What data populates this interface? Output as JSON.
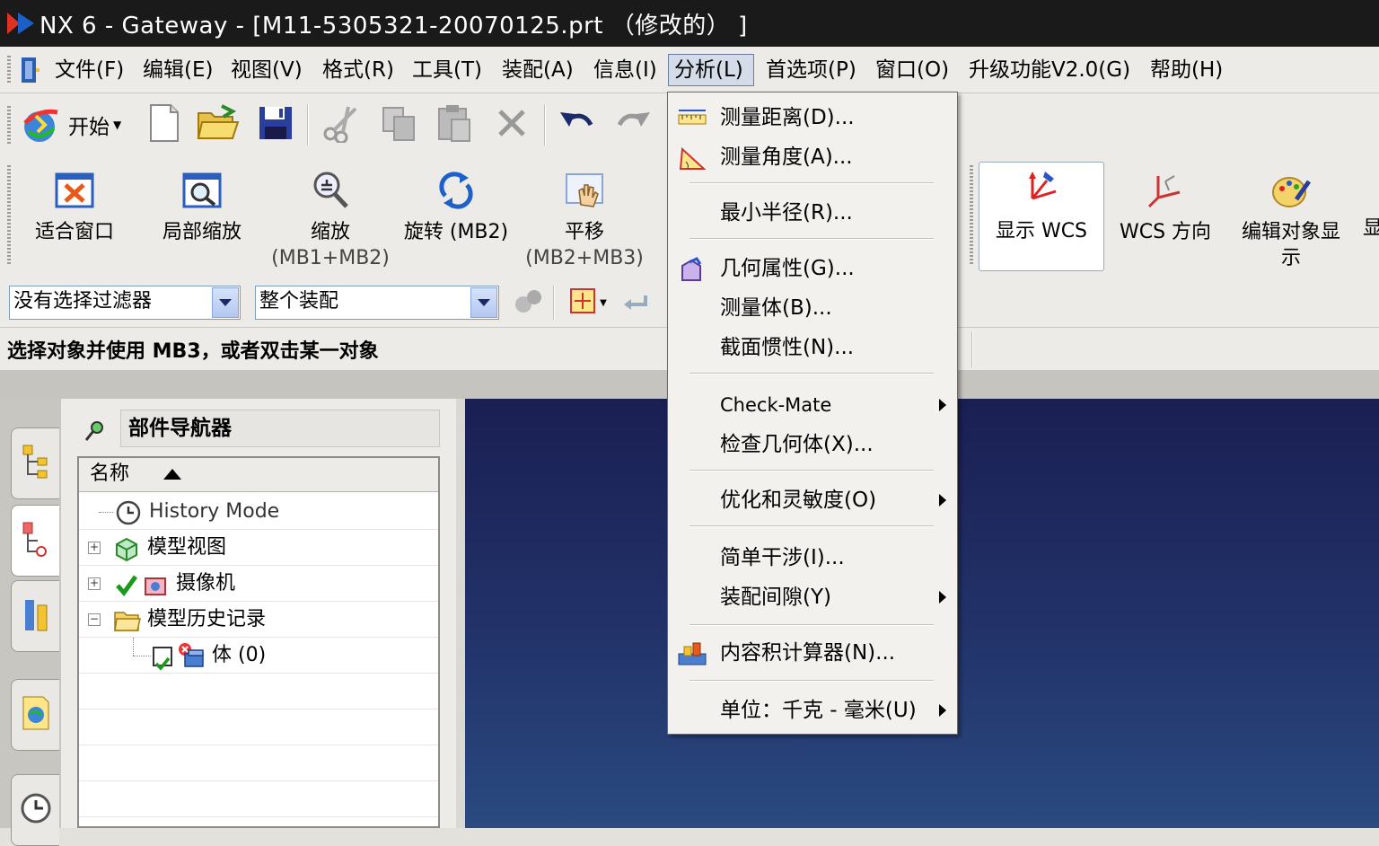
{
  "window": {
    "title": "NX 6 - Gateway - [M11-5305321-20070125.prt （修改的） ]"
  },
  "menubar": {
    "items": [
      {
        "label": "文件(F)"
      },
      {
        "label": "编辑(E)"
      },
      {
        "label": "视图(V)"
      },
      {
        "label": "格式(R)"
      },
      {
        "label": "工具(T)"
      },
      {
        "label": "装配(A)"
      },
      {
        "label": "信息(I)"
      },
      {
        "label": "分析(L)"
      },
      {
        "label": "首选项(P)"
      },
      {
        "label": "窗口(O)"
      },
      {
        "label": "升级功能V2.0(G)"
      },
      {
        "label": "帮助(H)"
      }
    ],
    "active_index": 7
  },
  "standard_toolbar": {
    "start_label": "开始"
  },
  "view_toolbar": {
    "fit": "适合窗口",
    "zoom_region": "局部缩放",
    "zoom": "缩放",
    "zoom_mb": "(MB1+MB2)",
    "rotate": "旋转 (MB2)",
    "pan": "平移",
    "pan_mb": "(MB2+MB3)"
  },
  "wcs_toolbar": {
    "show_wcs": "显示 WCS",
    "wcs_orient": "WCS 方向",
    "edit_display_1": "编辑对象显",
    "edit_display_2": "示",
    "clipped": "显"
  },
  "selection_bar": {
    "filter_value": "没有选择过滤器",
    "scope_value": "整个装配"
  },
  "status": {
    "prompt": "选择对象并使用 MB3，或者双击某一对象"
  },
  "navigator": {
    "title": "部件导航器",
    "column_name": "名称",
    "rows": [
      {
        "label": "History Mode"
      },
      {
        "label": "模型视图"
      },
      {
        "label": "摄像机"
      },
      {
        "label": "模型历史记录"
      },
      {
        "label": "体 (0)"
      }
    ]
  },
  "analysis_menu": {
    "items": [
      {
        "label": "测量距离(D)..."
      },
      {
        "label": "测量角度(A)..."
      },
      {
        "label": "最小半径(R)..."
      },
      {
        "label": "几何属性(G)..."
      },
      {
        "label": "测量体(B)..."
      },
      {
        "label": "截面惯性(N)..."
      },
      {
        "label": "Check-Mate"
      },
      {
        "label": "检查几何体(X)..."
      },
      {
        "label": "优化和灵敏度(O)"
      },
      {
        "label": "简单干涉(I)..."
      },
      {
        "label": "装配间隙(Y)"
      },
      {
        "label": "内容积计算器(N)..."
      },
      {
        "label": "单位：千克 - 毫米(U)"
      }
    ]
  },
  "colors": {
    "titlebar": "#1a1a1a",
    "chrome": "#ecebe7",
    "graphics_top": "#1a1f52",
    "graphics_bottom": "#2a4a80",
    "menu_highlight": "#d4dcea"
  }
}
